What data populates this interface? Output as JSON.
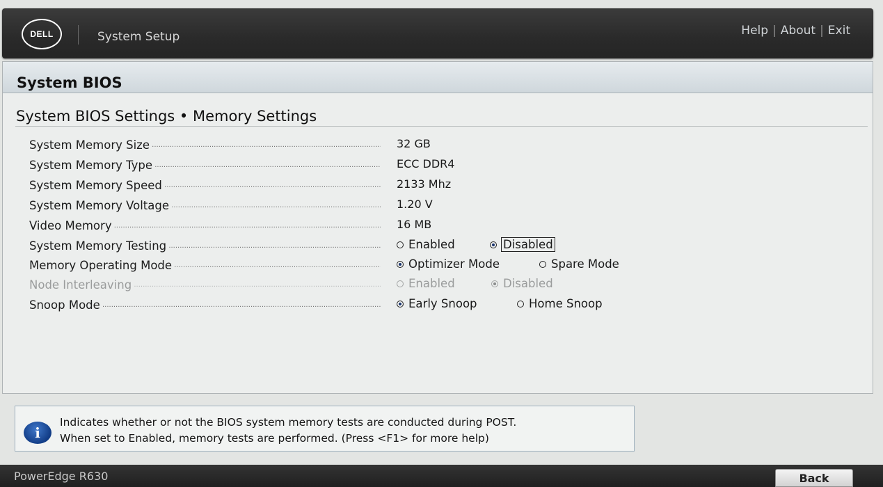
{
  "header": {
    "logo_text": "DELL",
    "app_title": "System Setup",
    "links": {
      "help": "Help",
      "about": "About",
      "exit": "Exit",
      "separator": "|"
    }
  },
  "panel": {
    "title": "System BIOS",
    "section_title": "System BIOS Settings • Memory Settings"
  },
  "settings": {
    "memory_size": {
      "label": "System Memory Size",
      "value": "32 GB"
    },
    "memory_type": {
      "label": "System Memory Type",
      "value": "ECC DDR4"
    },
    "memory_speed": {
      "label": "System Memory Speed",
      "value": "2133 Mhz"
    },
    "memory_voltage": {
      "label": "System Memory Voltage",
      "value": "1.20 V"
    },
    "video_memory": {
      "label": "Video Memory",
      "value": "16 MB"
    },
    "memory_testing": {
      "label": "System Memory Testing",
      "options": [
        "Enabled",
        "Disabled"
      ],
      "selected": "Disabled"
    },
    "operating_mode": {
      "label": "Memory Operating Mode",
      "options": [
        "Optimizer Mode",
        "Spare Mode"
      ],
      "selected": "Optimizer Mode"
    },
    "node_interleaving": {
      "label": "Node Interleaving",
      "options": [
        "Enabled",
        "Disabled"
      ],
      "selected": "Disabled",
      "disabled": true
    },
    "snoop_mode": {
      "label": "Snoop Mode",
      "options": [
        "Early Snoop",
        "Home Snoop"
      ],
      "selected": "Early Snoop"
    }
  },
  "help": {
    "icon": "info-icon",
    "line1": "Indicates whether or not the BIOS system memory tests are conducted during POST.",
    "line2": "When set to Enabled, memory tests are performed. (Press <F1> for more help)"
  },
  "footer": {
    "product": "PowerEdge R630",
    "back_label": "Back"
  },
  "colors": {
    "header_bg": "#2a2a2a",
    "panel_bg": "#eceeed",
    "radio_fill": "#1b3570",
    "info_icon": "#1a4a9c"
  }
}
